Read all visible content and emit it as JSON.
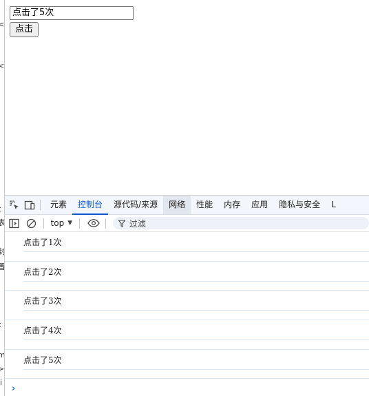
{
  "page": {
    "input_value": "点击了5次",
    "button_label": "点击"
  },
  "left_strip": {
    "fragments": [
      "<",
      "<",
      "t",
      "表",
      "封",
      "置",
      "t",
      "m",
      ">",
      "li"
    ]
  },
  "devtools": {
    "tabs": [
      {
        "label": "元素",
        "active": false
      },
      {
        "label": "控制台",
        "active": true
      },
      {
        "label": "源代码/来源",
        "active": false
      },
      {
        "label": "网络",
        "active": false
      },
      {
        "label": "性能",
        "active": false
      },
      {
        "label": "内存",
        "active": false
      },
      {
        "label": "应用",
        "active": false
      },
      {
        "label": "隐私与安全",
        "active": false
      },
      {
        "label": "L",
        "active": false
      }
    ],
    "toolbar": {
      "context": "top",
      "filter_placeholder": "过滤"
    },
    "console_logs": [
      "点击了1次",
      "点击了2次",
      "点击了3次",
      "点击了4次",
      "点击了5次"
    ],
    "prompt_symbol": "›"
  },
  "colors": {
    "accent": "#0b57d0",
    "tabbar_bg": "#f3f6fc",
    "log_divider": "#dbe6f3"
  }
}
